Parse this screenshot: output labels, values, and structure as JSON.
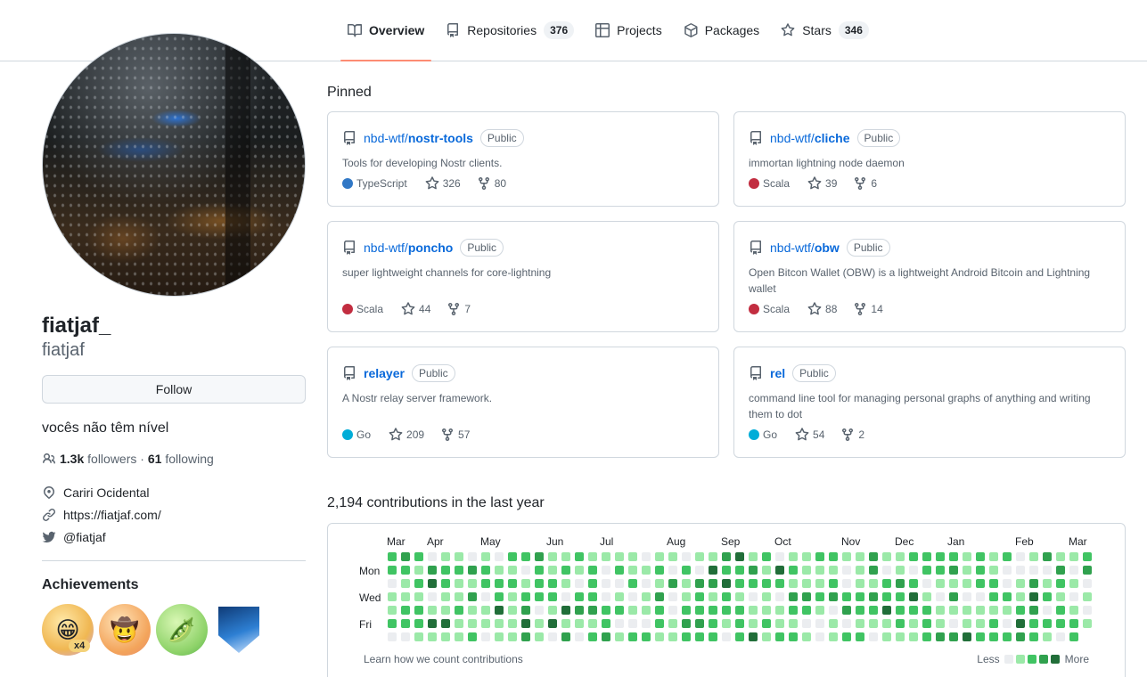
{
  "tabs": [
    {
      "label": "Overview",
      "icon": "book-icon"
    },
    {
      "label": "Repositories",
      "icon": "repo-icon",
      "count": "376"
    },
    {
      "label": "Projects",
      "icon": "table-icon"
    },
    {
      "label": "Packages",
      "icon": "package-icon"
    },
    {
      "label": "Stars",
      "icon": "star-icon",
      "count": "346"
    }
  ],
  "profile": {
    "fullname": "fiatjaf_",
    "login": "fiatjaf",
    "follow_label": "Follow",
    "bio": "vocês não têm nível",
    "followers_count": "1.3k",
    "followers_label": "followers",
    "separator": "·",
    "following_count": "61",
    "following_label": "following",
    "location": "Cariri Ocidental",
    "website": "https://fiatjaf.com/",
    "twitter": "@fiatjaf",
    "achievements_title": "Achievements",
    "achievement_multiplier": "x4"
  },
  "pinned": {
    "title": "Pinned",
    "public_label": "Public",
    "repos": [
      {
        "owner": "nbd-wtf/",
        "name": "nostr-tools",
        "desc": "Tools for developing Nostr clients.",
        "lang": "TypeScript",
        "lang_color": "#3178c6",
        "stars": "326",
        "forks": "80"
      },
      {
        "owner": "nbd-wtf/",
        "name": "cliche",
        "desc": "immortan lightning node daemon",
        "lang": "Scala",
        "lang_color": "#c22d40",
        "stars": "39",
        "forks": "6"
      },
      {
        "owner": "nbd-wtf/",
        "name": "poncho",
        "desc": "super lightweight channels for core-lightning",
        "lang": "Scala",
        "lang_color": "#c22d40",
        "stars": "44",
        "forks": "7"
      },
      {
        "owner": "nbd-wtf/",
        "name": "obw",
        "desc": "Open Bitcon Wallet (OBW) is a lightweight Android Bitcoin and Lightning wallet",
        "lang": "Scala",
        "lang_color": "#c22d40",
        "stars": "88",
        "forks": "14"
      },
      {
        "owner": "",
        "name": "relayer",
        "desc": "A Nostr relay server framework.",
        "lang": "Go",
        "lang_color": "#00add8",
        "stars": "209",
        "forks": "57"
      },
      {
        "owner": "",
        "name": "rel",
        "desc": "command line tool for managing personal graphs of anything and writing them to dot",
        "lang": "Go",
        "lang_color": "#00add8",
        "stars": "54",
        "forks": "2"
      }
    ]
  },
  "contributions": {
    "title": "2,194 contributions in the last year",
    "months": [
      "Mar",
      "Apr",
      "May",
      "Jun",
      "Jul",
      "Aug",
      "Sep",
      "Oct",
      "Nov",
      "Dec",
      "Jan",
      "Feb",
      "Mar"
    ],
    "days": [
      "Mon",
      "Wed",
      "Fri"
    ],
    "learn_link": "Learn how we count contributions",
    "less": "Less",
    "more": "More",
    "colors": [
      "#ebedf0",
      "#9be9a8",
      "#40c463",
      "#30a14e",
      "#216e39"
    ]
  }
}
